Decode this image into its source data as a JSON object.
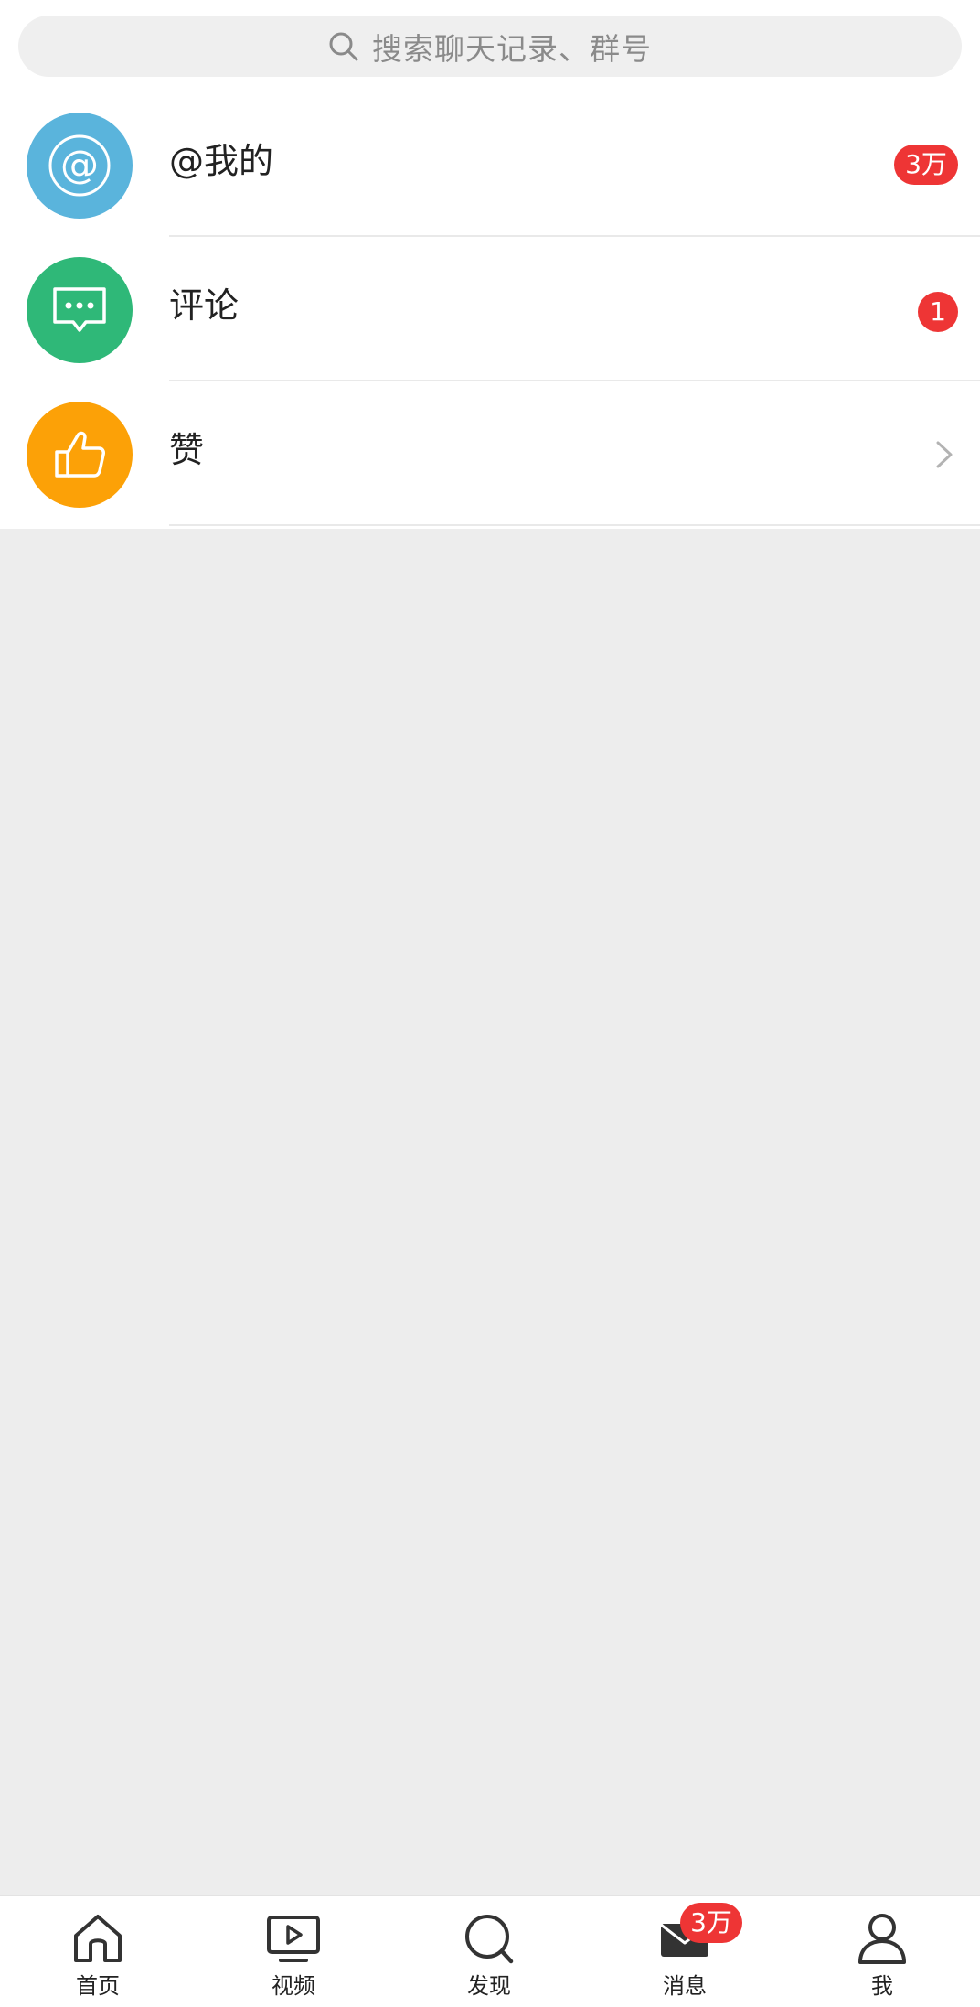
{
  "search": {
    "placeholder": "搜索聊天记录、群号"
  },
  "list": [
    {
      "label": "@我的",
      "badge": "3万",
      "icon": "at-icon",
      "color": "#5ab4dc"
    },
    {
      "label": "评论",
      "badge": "1",
      "icon": "comment-icon",
      "color": "#2fb878"
    },
    {
      "label": "赞",
      "icon": "thumbs-up-icon",
      "color": "#fca107"
    }
  ],
  "tab_bar": {
    "tabs": [
      {
        "label": "首页",
        "icon": "home-icon"
      },
      {
        "label": "视频",
        "icon": "video-icon"
      },
      {
        "label": "发现",
        "icon": "discover-icon"
      },
      {
        "label": "消息",
        "icon": "message-icon",
        "active": true
      },
      {
        "label": "我",
        "icon": "profile-icon"
      }
    ],
    "message_badge": "3万"
  },
  "colors": {
    "badge": "#ee3535",
    "background": "#ededed",
    "at_icon": "#5ab4dc",
    "comment_icon": "#2fb878",
    "like_icon": "#fca107"
  }
}
